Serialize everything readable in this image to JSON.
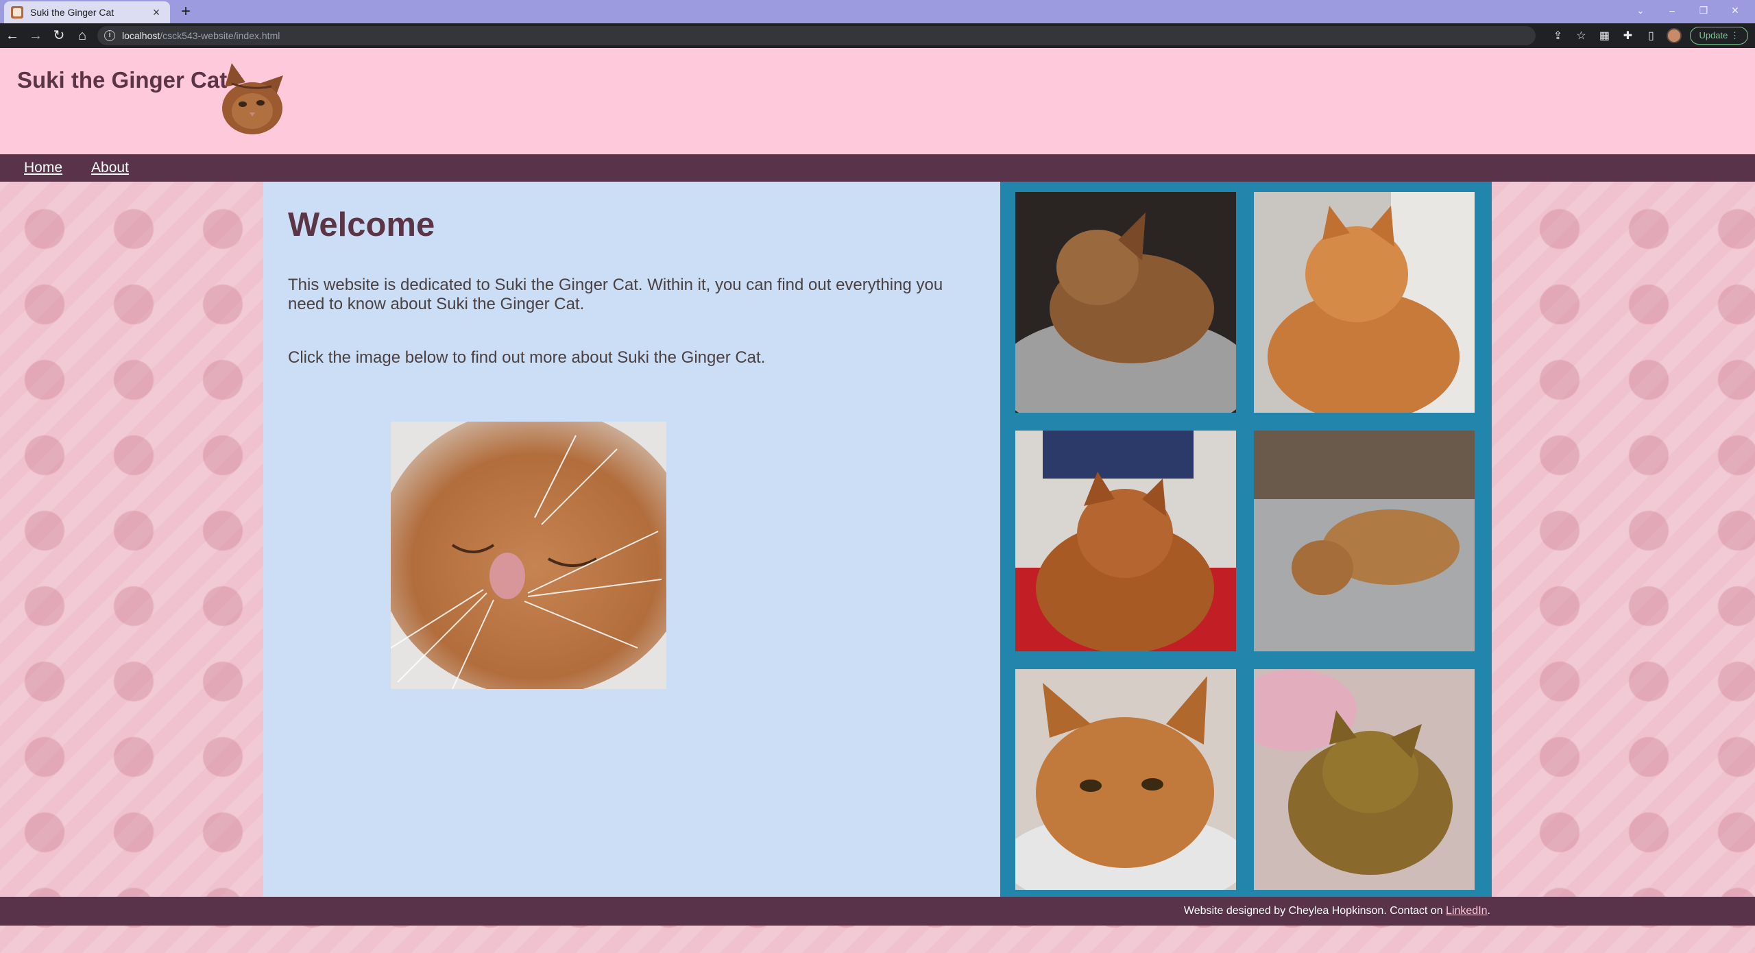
{
  "browser": {
    "tab_title": "Suki the Ginger Cat",
    "new_tab_label": "+",
    "url_host": "localhost",
    "url_path": "/csck543-website/index.html",
    "update_label": "Update"
  },
  "header": {
    "site_title": "Suki the Ginger Cat"
  },
  "nav": {
    "items": [
      {
        "label": "Home"
      },
      {
        "label": "About"
      }
    ]
  },
  "main": {
    "heading": "Welcome",
    "intro": "This website is dedicated to Suki the Ginger Cat. Within it, you can find out everything you need to know about Suki the Ginger Cat.",
    "click_prompt": "Click the image below to find out more about Suki the Ginger Cat."
  },
  "footer": {
    "credit": "Website designed by Cheylea Hopkinson. Contact on ",
    "link_label": "LinkedIn",
    "trailing": "."
  },
  "colors": {
    "header_bg": "#ffc9dc",
    "nav_bg": "#58334a",
    "main_bg": "#cbdef5",
    "gallery_bg": "#2286ac",
    "title_color": "#5b3445"
  },
  "icons": [
    "back-icon",
    "forward-icon",
    "reload-icon",
    "home-icon",
    "info-icon",
    "share-icon",
    "star-icon",
    "extensions-icon",
    "puzzle-icon",
    "sidepanel-icon",
    "menu-icon"
  ]
}
